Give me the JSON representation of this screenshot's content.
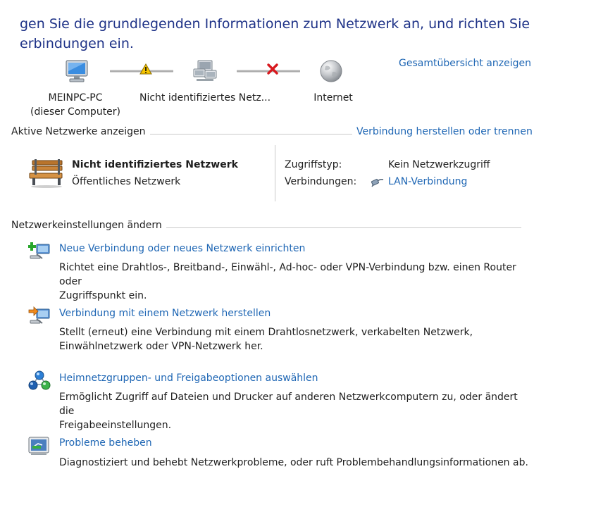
{
  "heading": {
    "line1": "gen Sie die grundlegenden Informationen zum Netzwerk an, und richten Sie",
    "line2": "erbindungen ein."
  },
  "network_map": {
    "computer": {
      "label1": "MEINPC-PC",
      "label2": "(dieser Computer)",
      "icon": "computer-icon"
    },
    "link1_status_icon": "warning-icon",
    "network": {
      "label": "Nicht identifiziertes Netz...",
      "icon": "network-icon"
    },
    "link2_status_icon": "red-x-icon",
    "internet": {
      "label": "Internet",
      "icon": "globe-icon"
    },
    "full_map_link": "Gesamtübersicht anzeigen"
  },
  "active_networks": {
    "section_title": "Aktive Netzwerke anzeigen",
    "connect_link": "Verbindung herstellen oder trennen",
    "network_name": "Nicht identifiziertes Netzwerk",
    "network_type": "Öffentliches Netzwerk",
    "network_icon": "park-bench-icon",
    "access_type_label": "Zugriffstyp:",
    "access_type_value": "Kein Netzwerkzugriff",
    "connections_label": "Verbindungen:",
    "connections_value": "LAN-Verbindung"
  },
  "settings": {
    "section_title": "Netzwerkeinstellungen ändern",
    "tasks": [
      {
        "icon": "new-connection-icon",
        "title": "Neue Verbindung oder neues Netzwerk einrichten",
        "desc1": "Richtet eine Drahtlos-, Breitband-, Einwähl-, Ad-hoc- oder VPN-Verbindung bzw. einen Router oder",
        "desc2": "Zugriffspunkt ein."
      },
      {
        "icon": "connect-network-icon",
        "title": "Verbindung mit einem Netzwerk herstellen",
        "desc1": "Stellt (erneut) eine Verbindung mit einem Drahtlosnetzwerk, verkabelten Netzwerk,",
        "desc2": "Einwählnetzwerk oder VPN-Netzwerk her."
      },
      {
        "icon": "homegroup-icon",
        "title": "Heimnetzgruppen- und Freigabeoptionen auswählen",
        "desc1": "Ermöglicht Zugriff auf Dateien und Drucker auf anderen Netzwerkcomputern zu, oder ändert die",
        "desc2": "Freigabeeinstellungen."
      },
      {
        "icon": "troubleshoot-icon",
        "title": "Probleme beheben",
        "desc1": "Diagnostiziert und behebt Netzwerkprobleme, oder ruft Problembehandlungsinformationen ab.",
        "desc2": ""
      }
    ]
  }
}
